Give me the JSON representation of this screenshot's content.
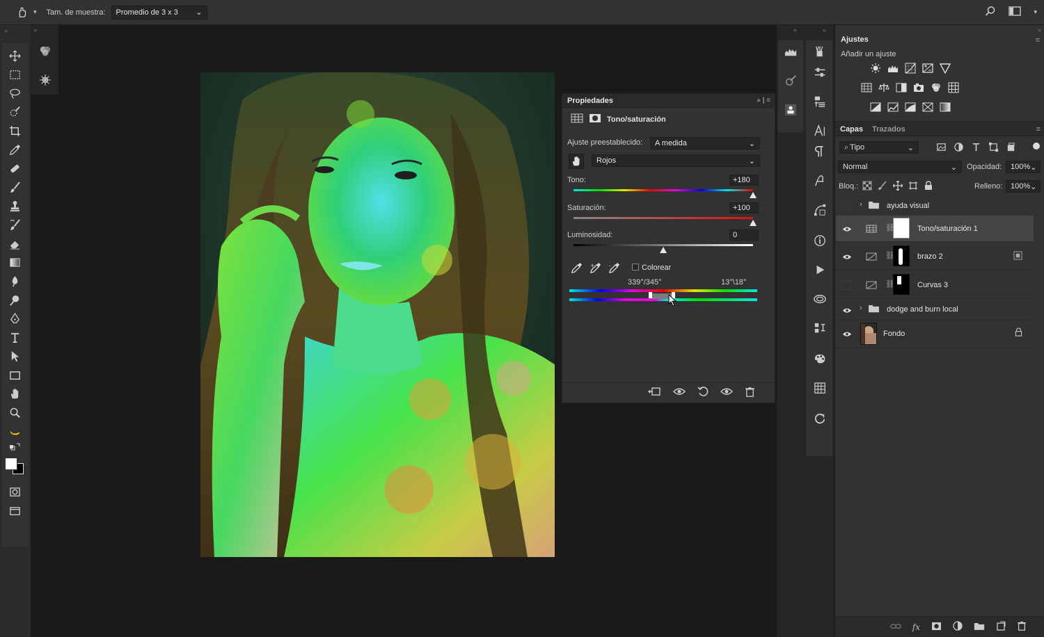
{
  "options_bar": {
    "sample_size_label": "Tam. de muestra:",
    "sample_size_value": "Promedio de 3 x 3"
  },
  "properties": {
    "panel_title": "Propiedades",
    "adjustment_name": "Tono/saturación",
    "preset_label": "Ajuste preestablecido:",
    "preset_value": "A medida",
    "channel_value": "Rojos",
    "hue_label": "Tono:",
    "hue_value": "+180",
    "saturation_label": "Saturación:",
    "saturation_value": "+100",
    "lightness_label": "Luminosidad:",
    "lightness_value": "0",
    "colorize_label": "Colorear",
    "range_left": "339°/345°",
    "range_right": "13°\\18°"
  },
  "adjustments": {
    "title": "Ajustes",
    "subtitle": "Añadir un ajuste"
  },
  "layers_panel": {
    "tab_layers": "Capas",
    "tab_paths": "Trazados",
    "filter_value": "Tipo",
    "blend_mode": "Normal",
    "opacity_label": "Opacidad:",
    "opacity_value": "100%",
    "lock_label": "Bloq.:",
    "fill_label": "Relleno:",
    "fill_value": "100%",
    "layers": [
      {
        "name": "ayuda visual",
        "type": "group",
        "visible": false
      },
      {
        "name": "Tono/saturación 1",
        "type": "hue-saturation",
        "visible": true,
        "selected": true
      },
      {
        "name": "brazo 2",
        "type": "curves",
        "visible": true
      },
      {
        "name": "Curvas 3",
        "type": "curves",
        "visible": false
      },
      {
        "name": "dodge and burn local",
        "type": "group",
        "visible": true
      },
      {
        "name": "Fondo",
        "type": "background",
        "visible": true,
        "locked": true
      }
    ]
  }
}
